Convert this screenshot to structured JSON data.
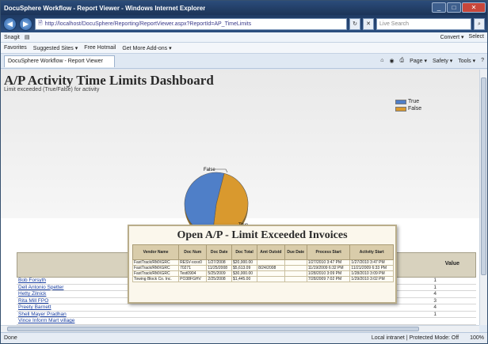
{
  "window": {
    "title": "DocuSphere Workflow - Report Viewer - Windows Internet Explorer",
    "buttons": [
      "_",
      "□",
      "✕"
    ]
  },
  "address_bar": {
    "url": "http://localhost/DocuSphere/Reporting/ReportViewer.aspx?ReportId=AP_TimeLimits",
    "search_placeholder": "Live Search"
  },
  "command_bar": {
    "left": [
      "Snagit",
      "▤"
    ],
    "right": [
      "Convert ▾",
      "Select"
    ]
  },
  "favorites_bar": {
    "items": [
      "Favorites",
      "Suggested Sites ▾",
      "Free Hotmail",
      "Get More Add-ons ▾"
    ]
  },
  "tabs": {
    "active": "DocuSphere Workflow - Report Viewer",
    "tools": [
      "Page ▾",
      "Safety ▾",
      "Tools ▾"
    ]
  },
  "dashboard": {
    "title": "A/P Activity Time Limits Dashboard",
    "subtitle": "Limit exceeded (True/False) for activity"
  },
  "chart_data": {
    "type": "pie",
    "title": "",
    "series": [
      {
        "name": "True",
        "values": [
          52
        ],
        "color": "#4f7fc8"
      },
      {
        "name": "False",
        "values": [
          48
        ],
        "color": "#d9992e"
      }
    ],
    "labels": [
      "True",
      "False"
    ],
    "legend": "top-right"
  },
  "grid": {
    "value_header": "Value",
    "rows": [
      {
        "label": "Bob Forsyth",
        "value": "1"
      },
      {
        "label": "Dell Antonio Spetter",
        "value": "1"
      },
      {
        "label": "Hetty Zilnick",
        "value": "4"
      },
      {
        "label": "Rita Mill FPO",
        "value": "3"
      },
      {
        "label": "Preety Barnett",
        "value": "4"
      },
      {
        "label": "Shell Mayer Pradhan",
        "value": "1"
      },
      {
        "label": "Vince Inform Mart village",
        "value": ""
      }
    ]
  },
  "popup": {
    "title": "Open A/P - Limit Exceeded Invoices",
    "columns": [
      "Vendor Name",
      "Doc Num",
      "Doc Date",
      "Doc Total",
      "Amt Outstd",
      "Due Date",
      "Process Start",
      "Activity Start"
    ],
    "rows": [
      [
        "FastTrack/RMXGRC",
        "RESV-xxxx0",
        "1/27/2008",
        "$20,000.00",
        "",
        "",
        "1/27/2010 3:47 PM",
        "1/27/2010 3:47 PM"
      ],
      [
        "FastTrack/RMXGRC",
        "70271",
        "11/25/2008",
        "$5,613.09",
        "8/24/2008",
        "",
        "11/19/2009 6:32 PM",
        "11/21/2009 6:33 PM"
      ],
      [
        "FastTrack/RMXGRC",
        "Test0904",
        "5/25/2009",
        "$30,000.00",
        "",
        "",
        "1/28/2010 3:09 PM",
        "1/28/2010 3:09 PM"
      ],
      [
        "Towing Block Co. Inc.",
        "PO38FGHV",
        "2/25/2008",
        "$1,445.00",
        "",
        "",
        "7/28/2009 7:02 PM",
        "1/29/2010 3:02 PM"
      ]
    ]
  },
  "status": {
    "left": "Done",
    "zone": "Local intranet | Protected Mode: Off",
    "zoom": "100%"
  }
}
